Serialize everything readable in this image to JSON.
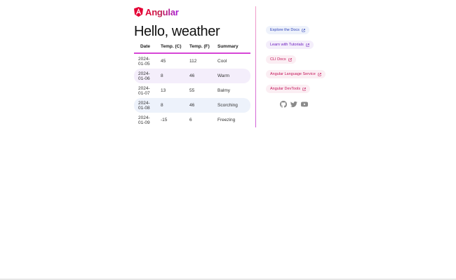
{
  "brand": {
    "name": "Angular"
  },
  "page": {
    "title": "Hello, weather"
  },
  "table": {
    "headers": [
      "Date",
      "Temp. (C)",
      "Temp. (F)",
      "Summary"
    ],
    "rows": [
      [
        "2024-01-05",
        "45",
        "112",
        "Cool"
      ],
      [
        "2024-01-06",
        "8",
        "46",
        "Warm"
      ],
      [
        "2024-01-07",
        "13",
        "55",
        "Balmy"
      ],
      [
        "2024-01-08",
        "8",
        "46",
        "Scorching"
      ],
      [
        "2024-01-09",
        "-15",
        "6",
        "Freezing"
      ]
    ]
  },
  "links": [
    {
      "label": "Explore the Docs",
      "icon": "external-link-icon"
    },
    {
      "label": "Learn with Tutorials",
      "icon": "external-link-icon"
    },
    {
      "label": "CLI Docs",
      "icon": "external-link-icon"
    },
    {
      "label": "Angular Language Service",
      "icon": "external-link-icon"
    },
    {
      "label": "Angular DevTools",
      "icon": "external-link-icon"
    }
  ],
  "social": [
    "github-icon",
    "twitter-icon",
    "youtube-icon"
  ],
  "colors": {
    "brand_red": "#e40035",
    "brand_purple": "#a71cdf",
    "header_rule": "#d746d7",
    "row_lavender": "#f4eefb",
    "row_blue": "#edf2fb",
    "social_icon": "#8a8a8a"
  }
}
